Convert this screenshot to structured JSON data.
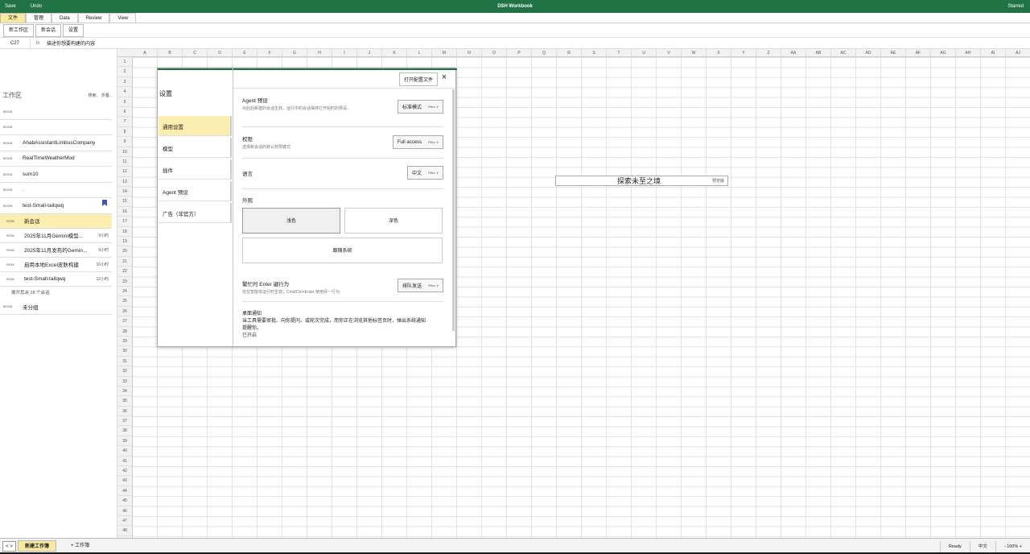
{
  "window": {
    "title": "DSH Workbook",
    "save": "Save",
    "undo": "Undo",
    "user": "Starred"
  },
  "ribbon_tabs": [
    "文件",
    "管理",
    "Data",
    "Review",
    "View"
  ],
  "toolbar": [
    "新工作区",
    "新会话",
    "设置"
  ],
  "formula_bar": {
    "cell": "C27",
    "fx": "fx",
    "text": "描述你想要构建的内容"
  },
  "columns": [
    "A",
    "B",
    "C",
    "D",
    "E",
    "F",
    "G",
    "H",
    "I",
    "J",
    "K",
    "L",
    "M",
    "N",
    "O",
    "P",
    "Q",
    "R",
    "S",
    "T",
    "U",
    "V",
    "W",
    "X",
    "Y",
    "Z",
    "AA",
    "AB",
    "AC",
    "AD",
    "AE",
    "AF",
    "AG",
    "AH",
    "AI",
    "AJ"
  ],
  "rows": [
    "1",
    "2",
    "3",
    "4",
    "5",
    "6",
    "7",
    "8",
    "9",
    "10",
    "11",
    "12",
    "13",
    "14",
    "15",
    "16",
    "17",
    "18",
    "19",
    "20",
    "21",
    "22",
    "23",
    "24",
    "25",
    "26",
    "27",
    "28",
    "29",
    "30",
    "31",
    "32",
    "33",
    "34",
    "35",
    "36",
    "37",
    "38",
    "39",
    "40",
    "41",
    "42",
    "43",
    "44",
    "45",
    "46",
    "47",
    "48"
  ],
  "sidebar": {
    "title": "工作区",
    "actions": "搜索、 折叠...",
    "items": [
      {
        "kind": "BOOK",
        "label": "",
        "time": ""
      },
      {
        "kind": "BOOK",
        "label": "",
        "time": ""
      },
      {
        "kind": "BOOK",
        "label": "AhabAssistantLimbusCompany",
        "time": ""
      },
      {
        "kind": "BOOK",
        "label": "RealTimeWeatherMod",
        "time": ""
      },
      {
        "kind": "BOOK",
        "label": "sum10",
        "time": ""
      },
      {
        "kind": "BOOK",
        "label": ".",
        "time": ""
      },
      {
        "kind": "BOOK",
        "label": "test-Small-tailqwq",
        "time": ""
      }
    ],
    "subitems": [
      {
        "kind": "ROW",
        "label": "新会话",
        "time": ""
      },
      {
        "kind": "ROW",
        "label": "2025年11月Gemini模型...",
        "time": "9小时"
      },
      {
        "kind": "ROW",
        "label": "2025年11月发布的Gemin...",
        "time": "9小时"
      },
      {
        "kind": "ROW",
        "label": "启用本地Excel皮肤构建",
        "time": "10小时"
      },
      {
        "kind": "ROW",
        "label": "test-Small-tailqwq",
        "time": "12小时"
      }
    ],
    "more": "展开其余 28 个会话",
    "ungrouped": {
      "kind": "BOOK",
      "label": "未分组"
    }
  },
  "dialog": {
    "title": "设置",
    "nav": [
      "通用设置",
      "模型",
      "插件",
      "Agent 预设",
      "广告（非官方）"
    ],
    "open_config": "打开配置文件",
    "close": "×",
    "sections": {
      "agent_preset": {
        "heading": "Agent 预设",
        "desc": "对此后新建的会话生效。运行中的会话保持它开始时的预设。",
        "value": "标准模式",
        "filter": "Filter ∨"
      },
      "permission": {
        "heading": "权限",
        "desc": "选择新会话的默认权限模式",
        "value": "Full access",
        "filter": "Filter ∨"
      },
      "language": {
        "heading": "语言",
        "value": "中文",
        "filter": "Filter ∨"
      },
      "appearance": {
        "heading": "外观",
        "light": "浅色",
        "dark": "深色",
        "system": "跟随系统"
      },
      "enter": {
        "heading": "繁忙时 Enter 键行为",
        "desc": "仅在智能体运行时生效；Cmd/Ctrl+Enter 使用另一行为",
        "value": "排队发送",
        "filter": "Filter ∨"
      },
      "notify": {
        "heading": "桌面通知",
        "desc": "当工具需要审批、向你提问、或轮次完成，而你正在浏览其他标签页时，弹出系统通知提醒你。",
        "state": "已开启"
      }
    }
  },
  "float_label": {
    "text": "探索未至之境",
    "badge": "预览版"
  },
  "status": {
    "nav": "< >",
    "sheet_active": "新建工作簿",
    "sheet_add": "+ 工作簿",
    "ready": "Ready",
    "lang": "中文",
    "zoom": "- 100% +"
  }
}
